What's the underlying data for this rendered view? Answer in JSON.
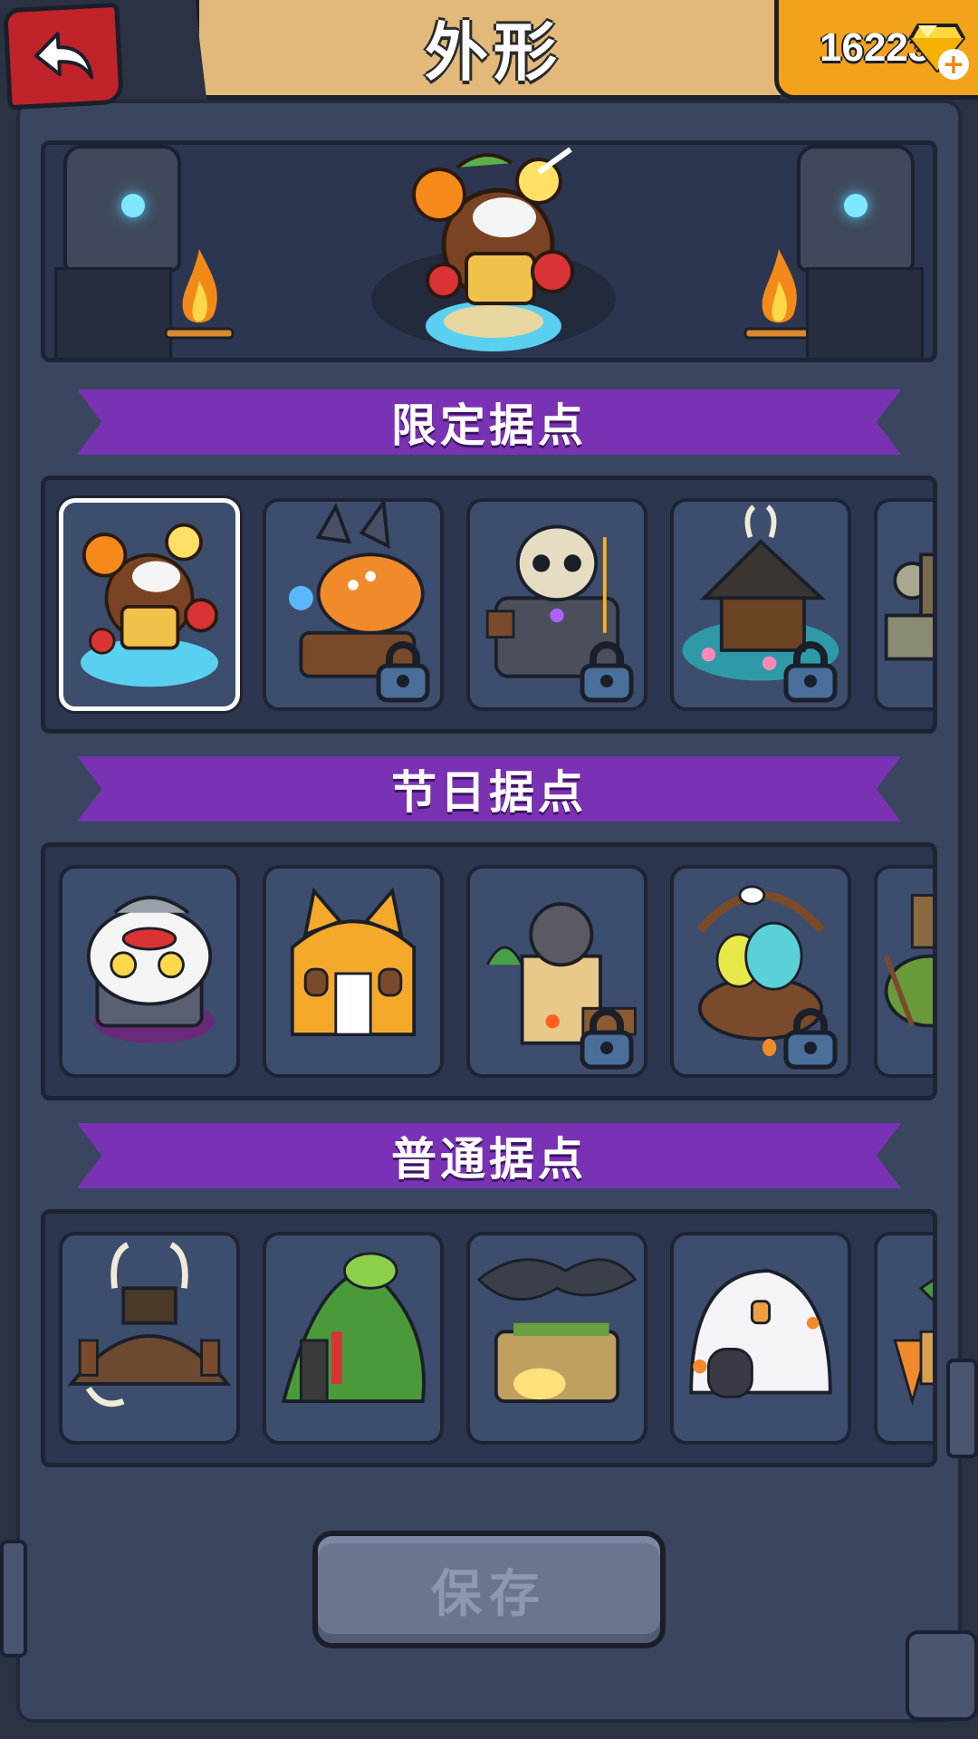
{
  "header": {
    "title": "外形",
    "currency": {
      "amount": "16223",
      "icon": "gem-icon",
      "add_icon": "plus-icon"
    },
    "back_icon": "back-arrow-icon"
  },
  "showcase": {
    "building": "coconut-island"
  },
  "sections": [
    {
      "title": "限定据点",
      "tiles": [
        {
          "name": "coconut-island",
          "locked": false,
          "selected": true
        },
        {
          "name": "stego-dino-camp",
          "locked": true
        },
        {
          "name": "skull-fortress",
          "locked": true
        },
        {
          "name": "horned-hut-pond",
          "locked": true
        },
        {
          "name": "stone-ruins",
          "locked": false
        }
      ]
    },
    {
      "title": "节日据点",
      "tiles": [
        {
          "name": "lion-dance-house",
          "locked": false
        },
        {
          "name": "corgi-house",
          "locked": false
        },
        {
          "name": "desert-palace",
          "locked": true
        },
        {
          "name": "easter-egg-basket",
          "locked": true
        },
        {
          "name": "windmill-camp",
          "locked": false
        }
      ]
    },
    {
      "title": "普通据点",
      "tiles": [
        {
          "name": "viking-war-camp",
          "locked": false
        },
        {
          "name": "leaf-hut",
          "locked": false
        },
        {
          "name": "tree-temple",
          "locked": false
        },
        {
          "name": "snow-igloo-house",
          "locked": false
        },
        {
          "name": "carrot-village",
          "locked": false
        }
      ]
    }
  ],
  "footer": {
    "save_label": "保存"
  },
  "colors": {
    "ribbon": "#7a32b4",
    "tile_bg": "#3d4d6d",
    "panel_bg": "#2c3650",
    "gem_box": "#f3a21b",
    "back_button": "#c0232a"
  }
}
